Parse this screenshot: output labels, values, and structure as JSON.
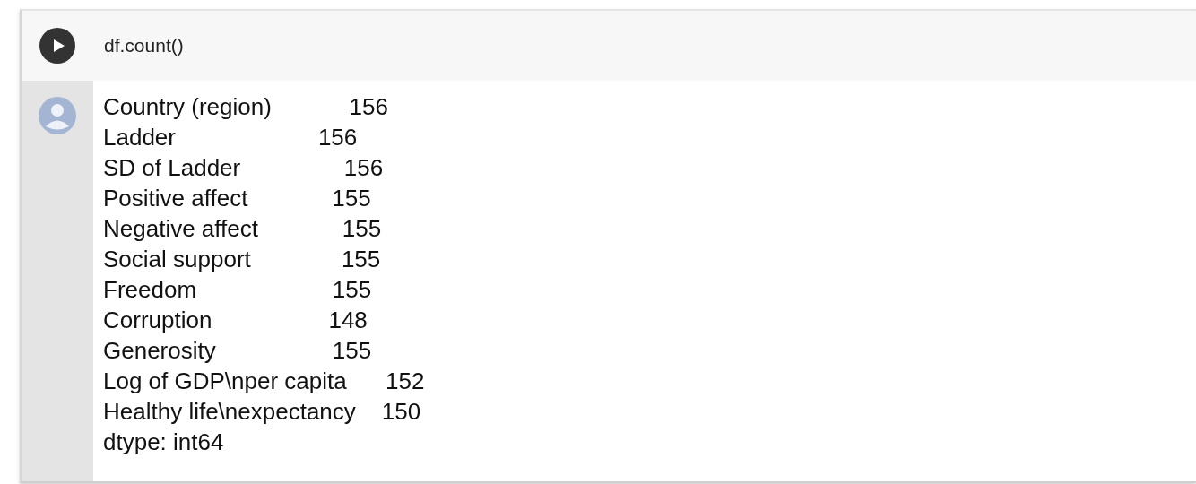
{
  "cell": {
    "code": "df.count()",
    "output_lines": [
      "Country (region)            156",
      "Ladder                      156",
      "SD of Ladder                156",
      "Positive affect             155",
      "Negative affect             155",
      "Social support              155",
      "Freedom                     155",
      "Corruption                  148",
      "Generosity                  155",
      "Log of GDP\\nper capita      152",
      "Healthy life\\nexpectancy    150",
      "dtype: int64"
    ]
  }
}
